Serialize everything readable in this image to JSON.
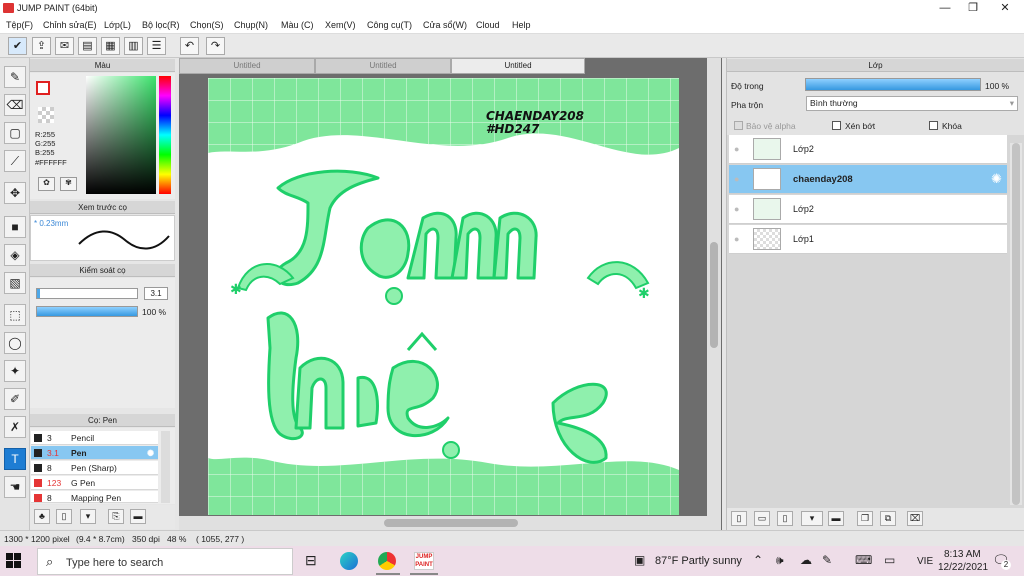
{
  "window": {
    "title": "JUMP PAINT (64bit)",
    "minimize": "—",
    "maximize": "❐",
    "close": "✕"
  },
  "menu": [
    "Tệp(F)",
    "Chỉnh sửa(E)",
    "Lớp(L)",
    "Bộ lọc(R)",
    "Chọn(S)",
    "Chụp(N)",
    "Màu (C)",
    "Xem(V)",
    "Công cụ(T)",
    "Cửa sổ(W)",
    "Cloud",
    "Help"
  ],
  "color_panel": {
    "title": "Màu",
    "r": "R:255",
    "g": "G:255",
    "b": "B:255",
    "hex": "#FFFFFF",
    "fg": "#ffffff",
    "bg": "#7ee39a"
  },
  "brush_preview": {
    "title": "Xem trước cọ",
    "size": "* 0.23mm"
  },
  "brush_control": {
    "title": "Kiểm soát cọ",
    "size_value": "3.1",
    "opacity_value": "100 %",
    "size_frac": 0.03,
    "opacity_frac": 1.0
  },
  "brush_list": {
    "title": "Cọ: Pen",
    "items": [
      {
        "size": "3",
        "name": "Pencil",
        "color": "#222222"
      },
      {
        "size": "3.1",
        "name": "Pen",
        "color": "#222222"
      },
      {
        "size": "8",
        "name": "Pen (Sharp)",
        "color": "#222222"
      },
      {
        "size": "123",
        "name": "G Pen",
        "color": "#e53535"
      },
      {
        "size": "8",
        "name": "Mapping Pen",
        "color": "#e53535"
      }
    ]
  },
  "tabs": [
    "Untitled",
    "Untitled",
    "Untitled"
  ],
  "artwork": {
    "watermark_line1": "CHAENDAY208",
    "watermark_line2": "#HD247",
    "word1": "lạm",
    "word2": "hiê",
    "accent": "#7fe69b",
    "stroke": "#1fcf6a"
  },
  "layers_panel": {
    "title": "Lớp",
    "opacity_label": "Độ trong",
    "opacity_value": "100 %",
    "opacity_frac": 1.0,
    "blend_label": "Pha trộn",
    "blend_value": "Bình thường",
    "protect_alpha": "Bảo vệ alpha",
    "clip": "Xén bớt",
    "lock": "Khóa",
    "items": [
      "Lớp2",
      "chaenday208",
      "Lớp2",
      "Lớp1"
    ]
  },
  "status": {
    "size": "1300 * 1200 pixel",
    "dims": "(9.4 * 8.7cm)",
    "dpi": "350 dpi",
    "zoom": "48 %",
    "coords": "( 1055, 277 )"
  },
  "taskbar": {
    "search_placeholder": "Type here to search",
    "weather": "87°F  Partly sunny",
    "lang": "VIE",
    "time": "8:13 AM",
    "date": "12/22/2021",
    "notif": "2"
  }
}
